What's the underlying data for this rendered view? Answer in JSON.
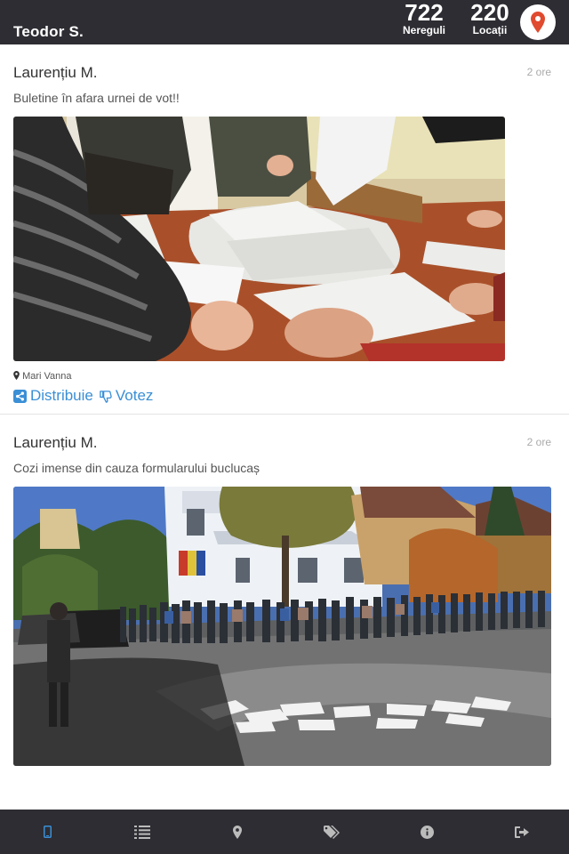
{
  "header": {
    "user_name": "Teodor S.",
    "stats": [
      {
        "value": "722",
        "label": "Nereguli"
      },
      {
        "value": "220",
        "label": "Locații"
      }
    ],
    "map_pin_icon": "map-marker-icon",
    "pin_color": "#e04a2f"
  },
  "posts": [
    {
      "author": "Laurențiu M.",
      "time": "2 ore",
      "text": "Buletine în afara urnei de vot!!",
      "photo_description_icon": "photo",
      "location": "Mari Vanna",
      "actions": {
        "share": "Distribuie",
        "vote": "Votez"
      }
    },
    {
      "author": "Laurențiu M.",
      "time": "2 ore",
      "text": "Cozi imense din cauza formularului buclucaș"
    }
  ],
  "bottom_tabs": [
    {
      "name": "mobile-icon",
      "active": true
    },
    {
      "name": "list-icon",
      "active": false
    },
    {
      "name": "map-marker-icon",
      "active": false
    },
    {
      "name": "tags-icon",
      "active": false
    },
    {
      "name": "info-icon",
      "active": false
    },
    {
      "name": "sign-out-icon",
      "active": false
    }
  ],
  "colors": {
    "bar_bg": "#2e2d33",
    "accent": "#3a8fd6",
    "icon_inactive": "#bbbbbb"
  }
}
